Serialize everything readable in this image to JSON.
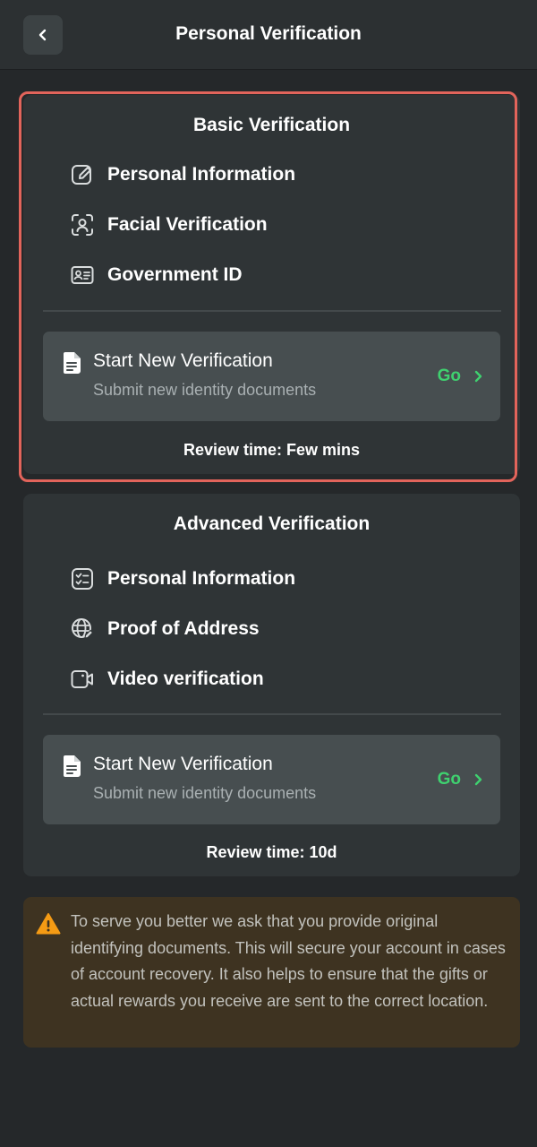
{
  "header": {
    "title": "Personal Verification",
    "back_icon": "chevron-left-icon"
  },
  "basic": {
    "title": "Basic Verification",
    "items": [
      {
        "label": "Personal Information",
        "icon": "edit-pen-icon"
      },
      {
        "label": "Facial Verification",
        "icon": "face-scan-icon"
      },
      {
        "label": "Government ID",
        "icon": "id-card-icon"
      }
    ],
    "action": {
      "title": "Start New Verification",
      "subtitle": "Submit new identity documents",
      "go_label": "Go"
    },
    "review": "Review time: Few mins"
  },
  "advanced": {
    "title": "Advanced Verification",
    "items": [
      {
        "label": "Personal Information",
        "icon": "checklist-icon"
      },
      {
        "label": "Proof of Address",
        "icon": "globe-edit-icon"
      },
      {
        "label": "Video verification",
        "icon": "video-camera-icon"
      }
    ],
    "action": {
      "title": "Start New Verification",
      "subtitle": "Submit new identity documents",
      "go_label": "Go"
    },
    "review": "Review time: 10d"
  },
  "notice": {
    "icon": "warning-icon",
    "text": "To serve you better we ask that you provide original identifying documents. This will secure your account in cases of account recovery. It also helps to ensure that the gifts or actual rewards you receive are sent to the correct location."
  },
  "colors": {
    "accent_go": "#3fd16f",
    "highlight_border": "#e2645b",
    "warning": "#f59b14"
  }
}
